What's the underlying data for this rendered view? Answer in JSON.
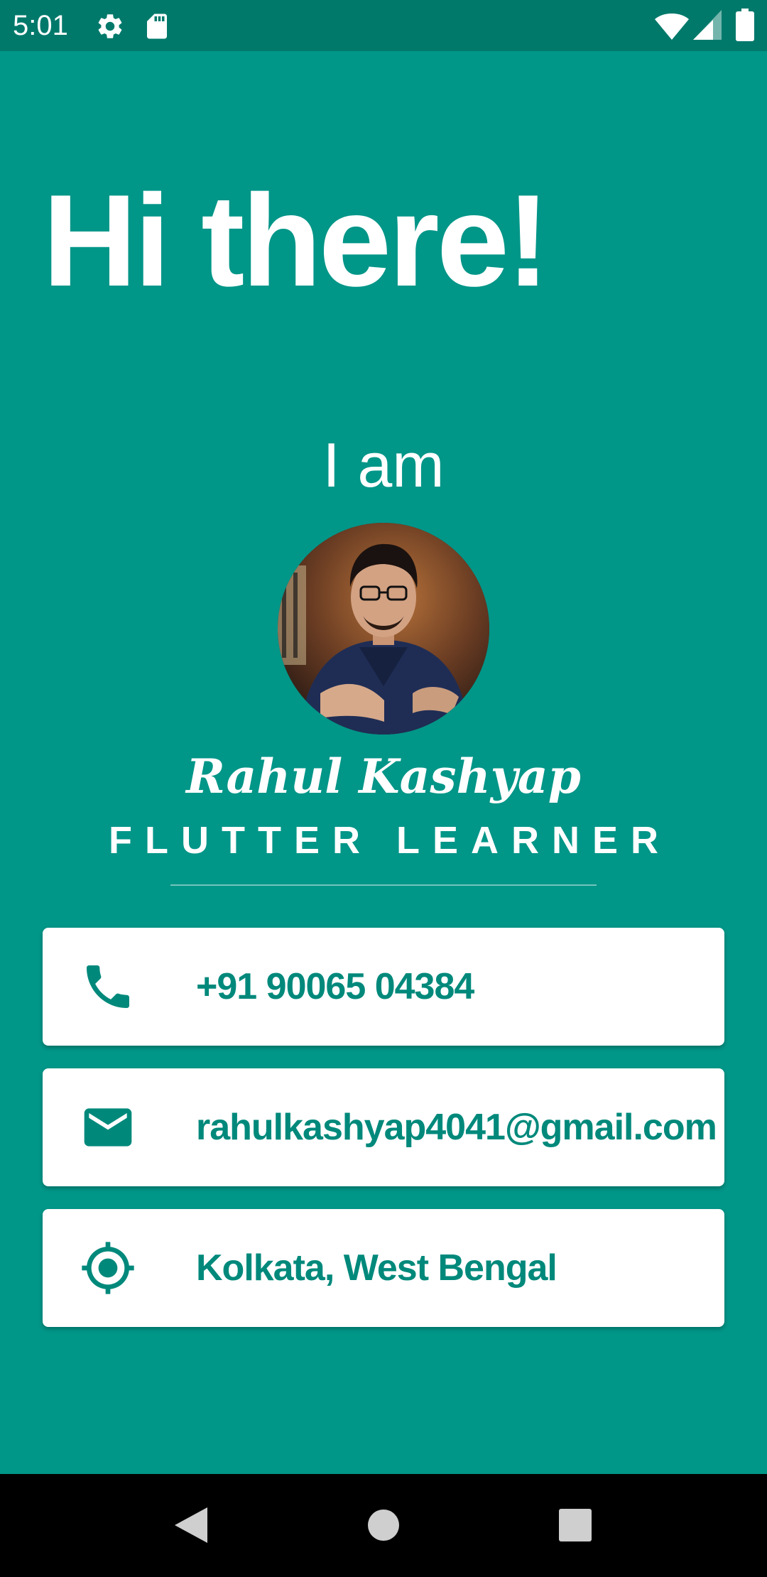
{
  "status_bar": {
    "time": "5:01",
    "icons": [
      "settings-icon",
      "sd-card-icon",
      "wifi-icon",
      "cell-signal-icon",
      "battery-icon"
    ]
  },
  "main": {
    "greeting": "Hi there!",
    "intro": "I am",
    "name": "Rahul Kashyap",
    "subtitle": "FLUTTER LEARNER"
  },
  "cards": [
    {
      "icon": "phone-icon",
      "text": "+91 90065 04384"
    },
    {
      "icon": "email-icon",
      "text": "rahulkashyap4041@gmail.com"
    },
    {
      "icon": "location-icon",
      "text": "Kolkata, West Bengal"
    }
  ],
  "nav": {
    "buttons": [
      "back-icon",
      "home-icon",
      "recents-icon"
    ]
  },
  "colors": {
    "background": "#009688",
    "status_bar": "#00796b",
    "card_text": "#00897b",
    "card_background": "#ffffff"
  }
}
